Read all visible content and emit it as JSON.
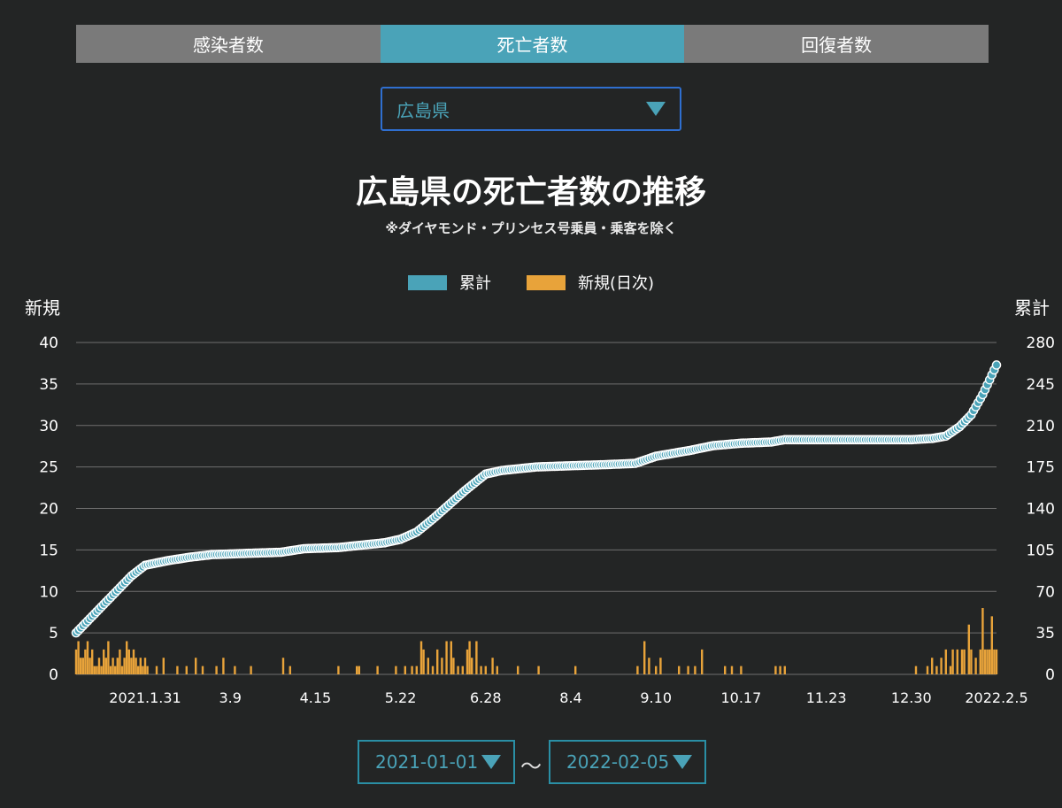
{
  "tabs": [
    {
      "label": "感染者数",
      "active": false
    },
    {
      "label": "死亡者数",
      "active": true
    },
    {
      "label": "回復者数",
      "active": false
    }
  ],
  "prefecture_select": {
    "value": "広島県"
  },
  "legend": {
    "cumulative": "累計",
    "daily": "新規(日次)"
  },
  "axes": {
    "left_title": "新規",
    "right_title": "累計"
  },
  "date_range": {
    "from": "2021-01-01",
    "separator": "〜",
    "to": "2022-02-05"
  },
  "colors": {
    "cumulative": "#4aa3b8",
    "daily": "#e8a33a",
    "active_tab": "#4aa3b8",
    "inactive_tab": "#7a7a7a",
    "grid": "#6f6f6f"
  },
  "chart_data": {
    "type": "bar+scatter",
    "title": "広島県の死亡者数の推移",
    "subtitle": "※ダイヤモンド・プリンセス号乗員・乗客を除く",
    "x_start": "2021-01-01",
    "x_end": "2022-02-05",
    "x_tick_labels": [
      {
        "date": "2021-01-31",
        "label": "2021.1.31"
      },
      {
        "date": "2021-03-09",
        "label": "3.9"
      },
      {
        "date": "2021-04-15",
        "label": "4.15"
      },
      {
        "date": "2021-05-22",
        "label": "5.22"
      },
      {
        "date": "2021-06-28",
        "label": "6.28"
      },
      {
        "date": "2021-08-04",
        "label": "8.4"
      },
      {
        "date": "2021-09-10",
        "label": "9.10"
      },
      {
        "date": "2021-10-17",
        "label": "10.17"
      },
      {
        "date": "2021-11-23",
        "label": "11.23"
      },
      {
        "date": "2021-12-30",
        "label": "12.30"
      },
      {
        "date": "2022-02-05",
        "label": "2022.2.5"
      }
    ],
    "left_axis": {
      "label": "新規",
      "min": 0,
      "max": 40,
      "ticks": [
        0,
        5,
        10,
        15,
        20,
        25,
        30,
        35,
        40
      ]
    },
    "right_axis": {
      "label": "累計",
      "min": 0,
      "max": 280,
      "ticks": [
        0,
        35,
        70,
        105,
        140,
        175,
        210,
        245,
        280
      ]
    },
    "series": [
      {
        "name": "累計",
        "kind": "scatter",
        "axis": "right",
        "points": [
          [
            "2021-01-01",
            35
          ],
          [
            "2021-01-05",
            43
          ],
          [
            "2021-01-10",
            53
          ],
          [
            "2021-01-15",
            63
          ],
          [
            "2021-01-20",
            73
          ],
          [
            "2021-01-25",
            83
          ],
          [
            "2021-01-31",
            92
          ],
          [
            "2021-02-10",
            96
          ],
          [
            "2021-02-20",
            99
          ],
          [
            "2021-03-01",
            101
          ],
          [
            "2021-03-15",
            102
          ],
          [
            "2021-03-31",
            103
          ],
          [
            "2021-04-10",
            106
          ],
          [
            "2021-04-25",
            107
          ],
          [
            "2021-05-05",
            109
          ],
          [
            "2021-05-15",
            111
          ],
          [
            "2021-05-22",
            114
          ],
          [
            "2021-05-29",
            120
          ],
          [
            "2021-06-05",
            131
          ],
          [
            "2021-06-12",
            143
          ],
          [
            "2021-06-19",
            155
          ],
          [
            "2021-06-28",
            169
          ],
          [
            "2021-07-05",
            172
          ],
          [
            "2021-07-20",
            175
          ],
          [
            "2021-08-04",
            176
          ],
          [
            "2021-08-20",
            177
          ],
          [
            "2021-09-01",
            178
          ],
          [
            "2021-09-10",
            184
          ],
          [
            "2021-09-25",
            189
          ],
          [
            "2021-10-05",
            193
          ],
          [
            "2021-10-17",
            195
          ],
          [
            "2021-10-30",
            196
          ],
          [
            "2021-11-05",
            198
          ],
          [
            "2021-11-23",
            198
          ],
          [
            "2021-12-15",
            198
          ],
          [
            "2021-12-30",
            198
          ],
          [
            "2022-01-08",
            199
          ],
          [
            "2022-01-14",
            201
          ],
          [
            "2022-01-20",
            209
          ],
          [
            "2022-01-25",
            219
          ],
          [
            "2022-01-30",
            236
          ],
          [
            "2022-02-05",
            261
          ]
        ]
      },
      {
        "name": "新規(日次)",
        "kind": "bar",
        "axis": "left",
        "points": [
          [
            "2021-01-01",
            3
          ],
          [
            "2021-01-02",
            4
          ],
          [
            "2021-01-03",
            2
          ],
          [
            "2021-01-04",
            2
          ],
          [
            "2021-01-05",
            3
          ],
          [
            "2021-01-06",
            4
          ],
          [
            "2021-01-07",
            2
          ],
          [
            "2021-01-08",
            3
          ],
          [
            "2021-01-09",
            1
          ],
          [
            "2021-01-10",
            1
          ],
          [
            "2021-01-11",
            2
          ],
          [
            "2021-01-12",
            1
          ],
          [
            "2021-01-13",
            3
          ],
          [
            "2021-01-14",
            2
          ],
          [
            "2021-01-15",
            4
          ],
          [
            "2021-01-16",
            1
          ],
          [
            "2021-01-17",
            2
          ],
          [
            "2021-01-18",
            1
          ],
          [
            "2021-01-19",
            2
          ],
          [
            "2021-01-20",
            3
          ],
          [
            "2021-01-21",
            1
          ],
          [
            "2021-01-22",
            2
          ],
          [
            "2021-01-23",
            4
          ],
          [
            "2021-01-24",
            3
          ],
          [
            "2021-01-25",
            2
          ],
          [
            "2021-01-26",
            3
          ],
          [
            "2021-01-27",
            2
          ],
          [
            "2021-01-28",
            1
          ],
          [
            "2021-01-29",
            2
          ],
          [
            "2021-01-30",
            1
          ],
          [
            "2021-01-31",
            2
          ],
          [
            "2021-02-01",
            1
          ],
          [
            "2021-02-05",
            1
          ],
          [
            "2021-02-08",
            2
          ],
          [
            "2021-02-14",
            1
          ],
          [
            "2021-02-18",
            1
          ],
          [
            "2021-02-22",
            2
          ],
          [
            "2021-02-25",
            1
          ],
          [
            "2021-03-03",
            1
          ],
          [
            "2021-03-06",
            2
          ],
          [
            "2021-03-11",
            1
          ],
          [
            "2021-03-18",
            1
          ],
          [
            "2021-04-01",
            2
          ],
          [
            "2021-04-04",
            1
          ],
          [
            "2021-04-25",
            1
          ],
          [
            "2021-05-03",
            1
          ],
          [
            "2021-05-04",
            1
          ],
          [
            "2021-05-12",
            1
          ],
          [
            "2021-05-20",
            1
          ],
          [
            "2021-05-24",
            1
          ],
          [
            "2021-05-27",
            1
          ],
          [
            "2021-05-29",
            1
          ],
          [
            "2021-05-31",
            4
          ],
          [
            "2021-06-01",
            3
          ],
          [
            "2021-06-03",
            2
          ],
          [
            "2021-06-05",
            1
          ],
          [
            "2021-06-07",
            3
          ],
          [
            "2021-06-09",
            2
          ],
          [
            "2021-06-11",
            4
          ],
          [
            "2021-06-13",
            4
          ],
          [
            "2021-06-14",
            2
          ],
          [
            "2021-06-16",
            1
          ],
          [
            "2021-06-18",
            1
          ],
          [
            "2021-06-20",
            3
          ],
          [
            "2021-06-21",
            4
          ],
          [
            "2021-06-22",
            2
          ],
          [
            "2021-06-24",
            4
          ],
          [
            "2021-06-26",
            1
          ],
          [
            "2021-06-28",
            1
          ],
          [
            "2021-07-01",
            2
          ],
          [
            "2021-07-03",
            1
          ],
          [
            "2021-07-12",
            1
          ],
          [
            "2021-07-21",
            1
          ],
          [
            "2021-08-06",
            1
          ],
          [
            "2021-09-02",
            1
          ],
          [
            "2021-09-05",
            4
          ],
          [
            "2021-09-07",
            2
          ],
          [
            "2021-09-10",
            1
          ],
          [
            "2021-09-12",
            2
          ],
          [
            "2021-09-20",
            1
          ],
          [
            "2021-09-24",
            1
          ],
          [
            "2021-09-27",
            1
          ],
          [
            "2021-09-30",
            3
          ],
          [
            "2021-10-10",
            1
          ],
          [
            "2021-10-13",
            1
          ],
          [
            "2021-10-17",
            1
          ],
          [
            "2021-11-01",
            1
          ],
          [
            "2021-11-03",
            1
          ],
          [
            "2021-11-05",
            1
          ],
          [
            "2022-01-01",
            1
          ],
          [
            "2022-01-06",
            1
          ],
          [
            "2022-01-08",
            2
          ],
          [
            "2022-01-10",
            1
          ],
          [
            "2022-01-12",
            2
          ],
          [
            "2022-01-14",
            3
          ],
          [
            "2022-01-16",
            1
          ],
          [
            "2022-01-17",
            3
          ],
          [
            "2022-01-19",
            3
          ],
          [
            "2022-01-21",
            3
          ],
          [
            "2022-01-22",
            3
          ],
          [
            "2022-01-24",
            6
          ],
          [
            "2022-01-25",
            3
          ],
          [
            "2022-01-27",
            2
          ],
          [
            "2022-01-29",
            3
          ],
          [
            "2022-01-30",
            8
          ],
          [
            "2022-01-31",
            3
          ],
          [
            "2022-02-01",
            3
          ],
          [
            "2022-02-02",
            3
          ],
          [
            "2022-02-03",
            7
          ],
          [
            "2022-02-04",
            3
          ],
          [
            "2022-02-05",
            3
          ]
        ]
      }
    ],
    "grid": true,
    "legend_position": "top-center"
  }
}
